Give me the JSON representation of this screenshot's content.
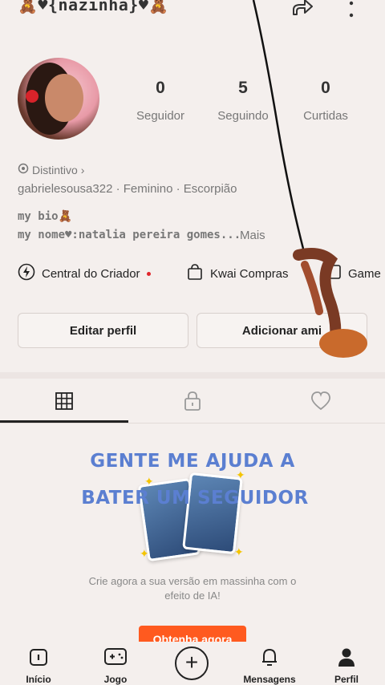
{
  "header": {
    "title": "🧸♥{nazinha}♥🧸"
  },
  "stats": [
    {
      "value": "0",
      "label": "Seguidor"
    },
    {
      "value": "5",
      "label": "Seguindo"
    },
    {
      "value": "0",
      "label": "Curtidas"
    }
  ],
  "profile": {
    "badge_label": "Distintivo",
    "meta": "gabrielesousa322 · Feminino · Escorpião",
    "bio_line1": "my bio🧸",
    "bio_line2": "my nome♥:natalia pereira gomes...",
    "more_label": "Mais"
  },
  "chips": [
    {
      "label": "Central do Criador"
    },
    {
      "label": "Kwai Compras"
    },
    {
      "label": "Game"
    }
  ],
  "buttons": {
    "edit": "Editar perfil",
    "add": "Adicionar ami"
  },
  "promo": {
    "line1": "GENTE ME AJUDA A",
    "line2": "BATER UM SEGUIDOR",
    "desc_line1": "Crie agora a sua versão em massinha com o",
    "desc_line2": "efeito de IA!",
    "cta": "Obtenha agora"
  },
  "nav": [
    {
      "label": "Início",
      "icon": "home-icon"
    },
    {
      "label": "Jogo",
      "icon": "gamepad-icon"
    },
    {
      "label": "Mensagens",
      "icon": "bell-icon"
    },
    {
      "label": "Perfil",
      "icon": "person-icon"
    }
  ],
  "colors": {
    "accent": "#ff5a1f",
    "promo_text": "#5b7fd1",
    "dot": "#e0262c"
  }
}
